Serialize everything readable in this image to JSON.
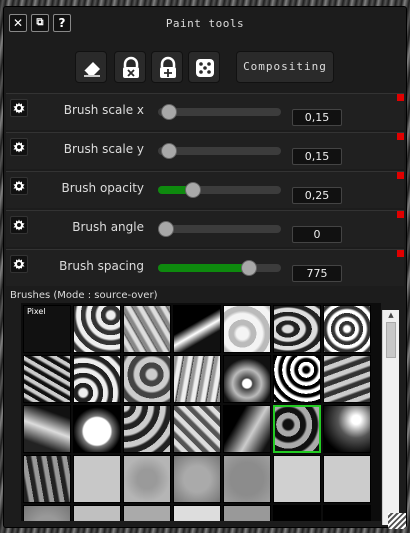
{
  "window": {
    "title": "Paint tools",
    "close_glyph": "✕",
    "restore_glyph": "⧉",
    "help_glyph": "?"
  },
  "toolbar": {
    "tools": [
      {
        "name": "eraser-icon"
      },
      {
        "name": "brush-lock-icon"
      },
      {
        "name": "brush-unlock-icon"
      },
      {
        "name": "dice-icon"
      }
    ],
    "compositing_label": "Compositing"
  },
  "parameters": [
    {
      "label": "Brush scale x",
      "value": "0,15",
      "slider_fraction": 0.03,
      "filled": false,
      "accent": "#e00000"
    },
    {
      "label": "Brush scale y",
      "value": "0,15",
      "slider_fraction": 0.03,
      "filled": false,
      "accent": "#e00000"
    },
    {
      "label": "Brush opacity",
      "value": "0,25",
      "slider_fraction": 0.25,
      "filled": true,
      "accent": "#e00000"
    },
    {
      "label": "Brush angle",
      "value": "0",
      "slider_fraction": 0.0,
      "filled": false,
      "accent": "#e00000"
    },
    {
      "label": "Brush spacing",
      "value": "775",
      "slider_fraction": 0.78,
      "filled": true,
      "accent": "#e00000"
    }
  ],
  "brushes": {
    "label": "Brushes (Mode : source-over)",
    "first_label": "Pixel",
    "selected_index": 19
  },
  "colors": {
    "slider_fill": "#0e8a0e",
    "selection": "#22cc22",
    "marker": "#e00000"
  }
}
